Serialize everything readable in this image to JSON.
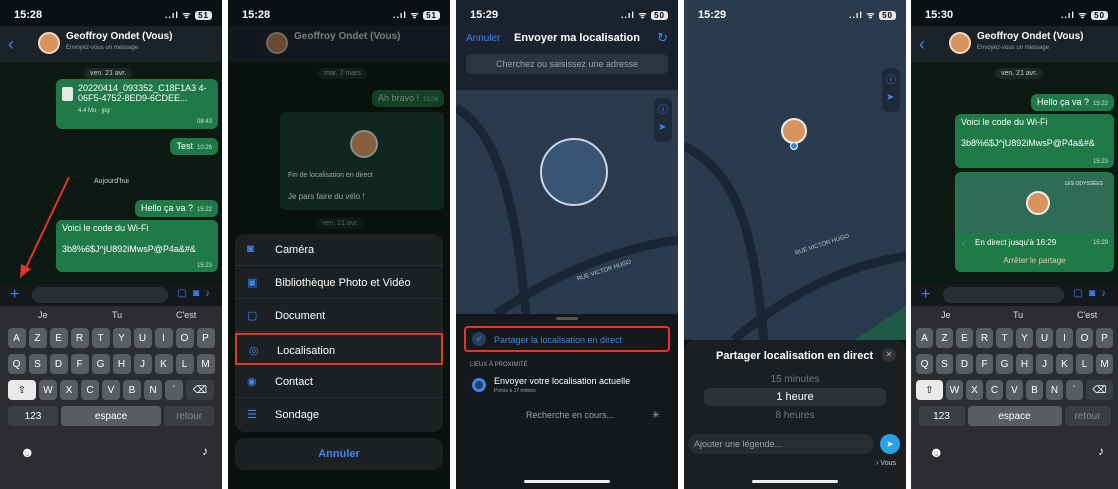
{
  "p1": {
    "time": "15:28",
    "status": "..ıl ᯤ",
    "battery": "51",
    "chat_name": "Geoffroy Ondet (Vous)",
    "chat_sub": "Envoyez-vous un message",
    "date1": "ven. 21 avr.",
    "file_name": "20220414_093352_C18F1A3 4-06F5-4752-8ED9-6CDEE...",
    "file_meta": "4,4 Mo · jpg",
    "file_time": "08:43",
    "test_msg": "Test",
    "test_time": "10:26",
    "today": "Aujourd'hui",
    "hello_msg": "Hello ça va ?",
    "hello_time": "15:22",
    "wifi_msg": "Voici le code du Wi-Fi",
    "wifi_code": "3b8%6$J^jU892iMwsP@P4a&#&",
    "wifi_time": "15:23",
    "sugg": [
      "Je",
      "Tu",
      "C'est"
    ],
    "row1": [
      "A",
      "Z",
      "E",
      "R",
      "T",
      "Y",
      "U",
      "I",
      "O",
      "P"
    ],
    "row2": [
      "Q",
      "S",
      "D",
      "F",
      "G",
      "H",
      "J",
      "K",
      "L",
      "M"
    ],
    "row3": [
      "W",
      "X",
      "C",
      "V",
      "B",
      "N",
      "´"
    ],
    "num_key": "123",
    "space_key": "espace",
    "return_key": "retour"
  },
  "p2": {
    "time": "15:28",
    "status": "..ıl ᯤ",
    "battery": "51",
    "chat_name": "Geoffroy Ondet (Vous)",
    "date": "mar. 7 mars",
    "bravo": "Ah bravo !",
    "bravo_time": "15:06",
    "live_end": "Fin de localisation en direct",
    "velo": "Je pars faire du vélo !",
    "velo_time": "15:10",
    "date2": "ven. 21 avr.",
    "menu": [
      {
        "icon": "camera-icon",
        "glyph": "◙",
        "label": "Caméra"
      },
      {
        "icon": "photo-library-icon",
        "glyph": "▣",
        "label": "Bibliothèque Photo et Vidéo"
      },
      {
        "icon": "document-icon",
        "glyph": "▢",
        "label": "Document"
      },
      {
        "icon": "location-icon",
        "glyph": "◎",
        "label": "Localisation"
      },
      {
        "icon": "contact-icon",
        "glyph": "◉",
        "label": "Contact"
      },
      {
        "icon": "poll-icon",
        "glyph": "☰",
        "label": "Sondage"
      }
    ],
    "cancel": "Annuler"
  },
  "p3": {
    "time": "15:29",
    "status": "..ıl ᯤ",
    "battery": "50",
    "cancel": "Annuler",
    "title": "Envoyer ma localisation",
    "search_placeholder": "Cherchez ou saisissez une adresse",
    "street": "RUE VICTOR HUGO",
    "live_share": "Partager la localisation en direct",
    "nearby": "LIEUX À PROXIMITÉ",
    "send_current": "Envoyer votre localisation actuelle",
    "accuracy": "Précis à 17 mètres",
    "searching": "Recherche en cours..."
  },
  "p4": {
    "time": "15:29",
    "status": "..ıl ᯤ",
    "battery": "50",
    "street": "RUE VICTOR HUGO",
    "sheet_title": "Partager localisation en direct",
    "opt1": "15 minutes",
    "opt2": "1 heure",
    "opt3": "8 heures",
    "caption_placeholder": "Ajouter une légende...",
    "to": "› Vous"
  },
  "p5": {
    "time": "15:30",
    "status": "..ıl ᯤ",
    "battery": "50",
    "chat_name": "Geoffroy Ondet (Vous)",
    "chat_sub": "Envoyez-vous un message",
    "date": "ven. 21 avr.",
    "hello_msg": "Hello ça va ?",
    "hello_time": "15:22",
    "wifi_msg": "Voici le code du Wi-Fi",
    "wifi_code": "3b8%6$J^jU892iMwsP@P4a&#&",
    "wifi_time": "15:23",
    "map_label": "LES ODYSSÉES",
    "live_until": "En direct jusqu'à 16:29",
    "live_time": "15:29",
    "stop": "Arrêter le partage",
    "sugg": [
      "Je",
      "Tu",
      "C'est"
    ],
    "row1": [
      "A",
      "Z",
      "E",
      "R",
      "T",
      "Y",
      "U",
      "I",
      "O",
      "P"
    ],
    "row2": [
      "Q",
      "S",
      "D",
      "F",
      "G",
      "H",
      "J",
      "K",
      "L",
      "M"
    ],
    "row3": [
      "W",
      "X",
      "C",
      "V",
      "B",
      "N",
      "´"
    ],
    "num_key": "123",
    "space_key": "espace",
    "return_key": "retour"
  },
  "colors": {
    "accent": "#3d86f0",
    "bubble": "#1f7a48",
    "highlight": "#e53528"
  }
}
